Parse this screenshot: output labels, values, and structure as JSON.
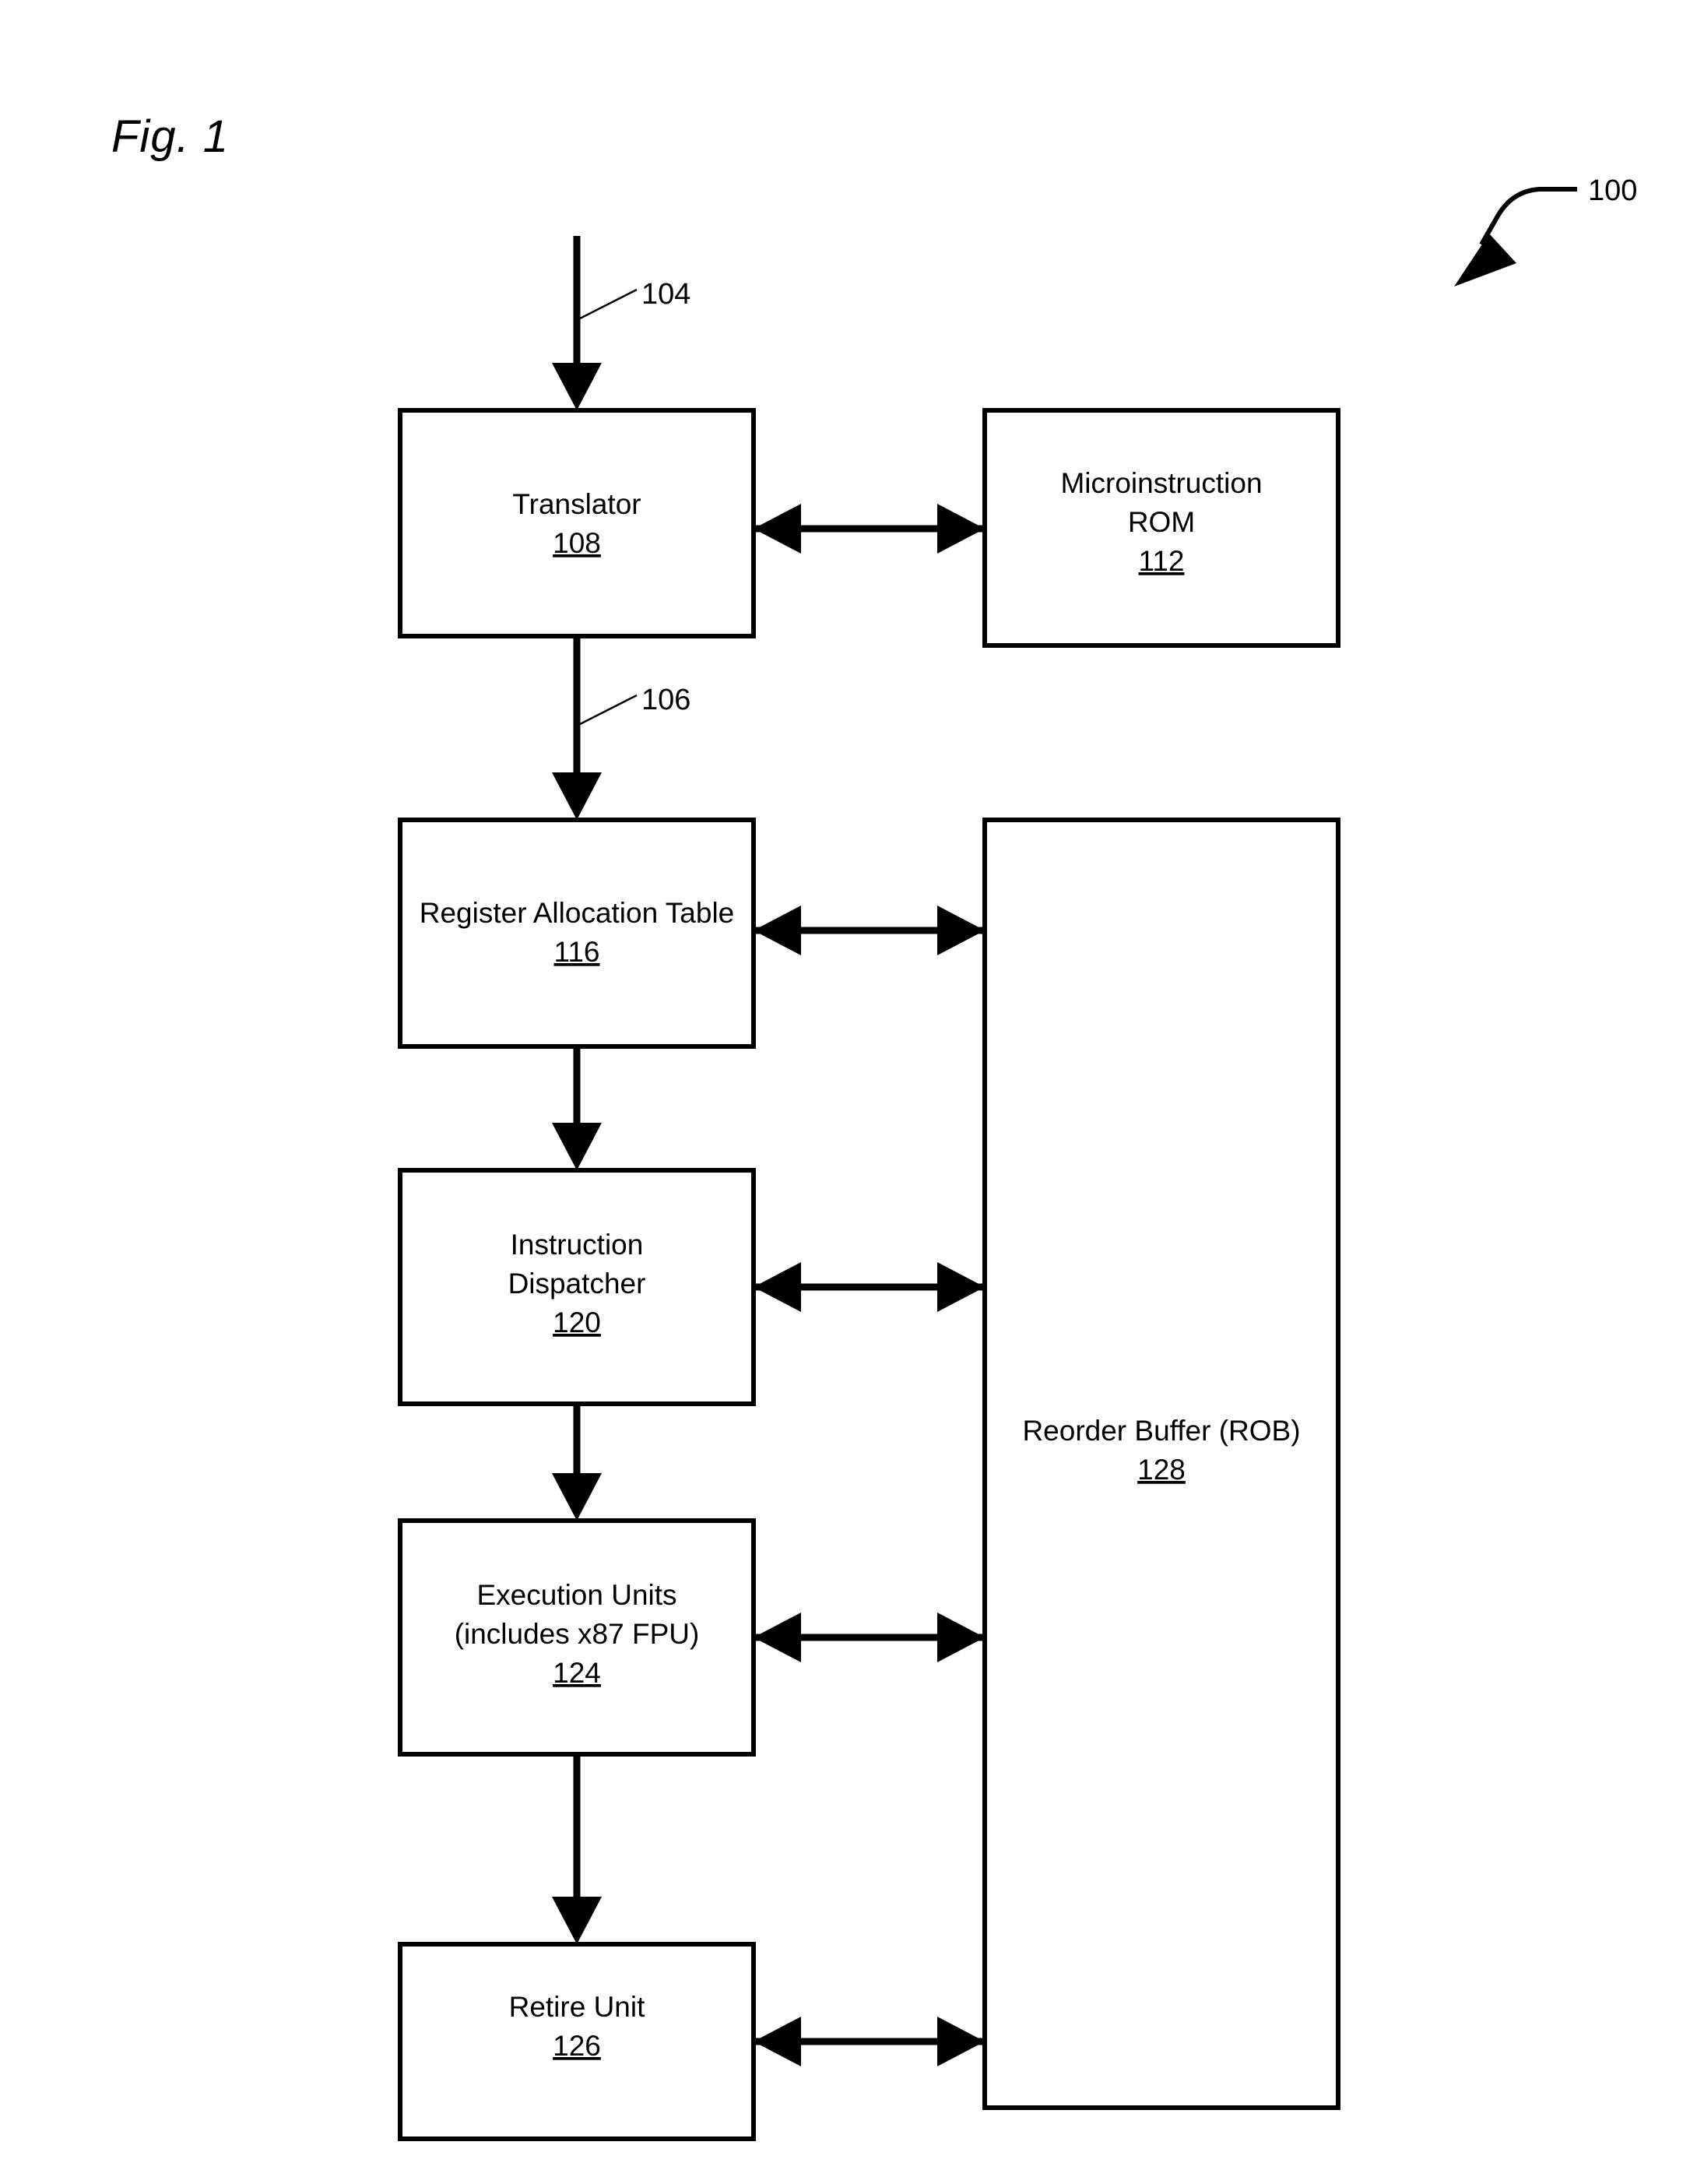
{
  "figure": {
    "label": "Fig. 1",
    "system_ref": "100"
  },
  "signals": [
    {
      "id": "sig-104",
      "label": "104"
    },
    {
      "id": "sig-106",
      "label": "106"
    }
  ],
  "blocks": [
    {
      "id": "translator",
      "lines": [
        "Translator"
      ],
      "ref": "108"
    },
    {
      "id": "microinstruction-rom",
      "lines": [
        "Microinstruction",
        "ROM"
      ],
      "ref": "112"
    },
    {
      "id": "register-allocation-table",
      "lines": [
        "Register Allocation Table"
      ],
      "ref": "116"
    },
    {
      "id": "instruction-dispatcher",
      "lines": [
        "Instruction",
        "Dispatcher"
      ],
      "ref": "120"
    },
    {
      "id": "execution-units",
      "lines": [
        "Execution Units",
        "(includes x87 FPU)"
      ],
      "ref": "124"
    },
    {
      "id": "retire-unit",
      "lines": [
        "Retire Unit"
      ],
      "ref": "126"
    },
    {
      "id": "reorder-buffer",
      "lines": [
        "Reorder Buffer (ROB)"
      ],
      "ref": "128"
    }
  ],
  "colors": {
    "ink": "#000000",
    "paper": "#ffffff"
  }
}
